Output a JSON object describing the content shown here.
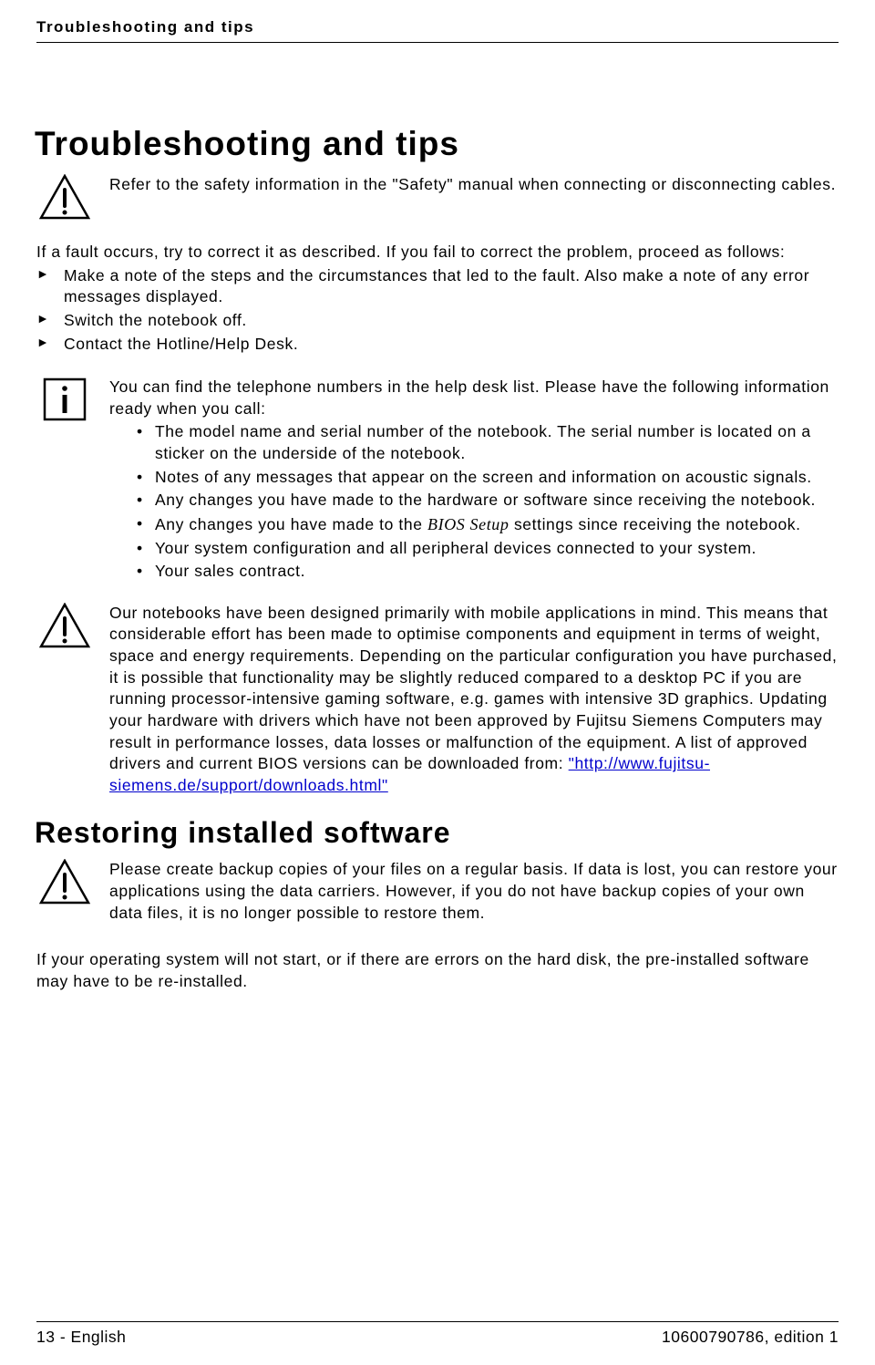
{
  "header": {
    "running_title": "Troubleshooting and tips"
  },
  "h1": "Troubleshooting and tips",
  "warn1": {
    "text": "Refer to the safety information in the \"Safety\" manual when connecting or disconnecting cables."
  },
  "intro": {
    "p1": "If a fault occurs, try to correct it as described.  If you fail to correct the problem, proceed as follows:",
    "items": [
      "Make a note of the steps and the circumstances that led to the fault.  Also make a note of any error messages displayed.",
      "Switch the notebook off.",
      "Contact the Hotline/Help Desk."
    ]
  },
  "info": {
    "lead": "You can find the telephone numbers in the help desk list.  Please have the following information ready when you call:",
    "items": [
      "The model name and serial number of the notebook.  The serial number is located on a sticker on the underside of the notebook.",
      "Notes of any messages that appear on the screen and information on acoustic signals.",
      "Any changes you have made to the hardware or software since receiving the notebook.",
      {
        "pre": "Any changes you have made to the ",
        "italic": "BIOS Setup",
        "post": " settings since receiving the notebook."
      },
      "Your system configuration and all peripheral devices connected to your system.",
      "Your sales contract."
    ]
  },
  "warn2": {
    "pre": "Our notebooks have been designed primarily with mobile applications in mind. This means that considerable effort has been made to optimise components and equipment in terms of weight, space and energy requirements.  Depending on the particular configuration you have purchased, it is possible that functionality may be slightly reduced compared to a desktop PC if you are running processor-intensive gaming software, e.g.  games with intensive 3D graphics.  Updating your hardware with drivers which have not been approved by Fujitsu Siemens Computers may result in performance losses, data losses or malfunction of the equipment.  A list of approved drivers and current BIOS versions can be downloaded from: ",
    "link_text": "\"http://www.fujitsu-siemens.de/support/downloads.html\"",
    "link_href": "http://www.fujitsu-siemens.de/support/downloads.html"
  },
  "h2": "Restoring installed software",
  "warn3": {
    "text": "Please create backup copies of your files on a regular basis.  If data is lost, you can restore your applications using the data carriers.  However, if you do not have backup copies of your own data files, it is no longer possible to restore them."
  },
  "after_restore": "If your operating system will not start, or if there are errors on the hard disk, the pre-installed software may have to be re-installed.",
  "footer": {
    "left": "13 - English",
    "right": "10600790786, edition 1"
  }
}
